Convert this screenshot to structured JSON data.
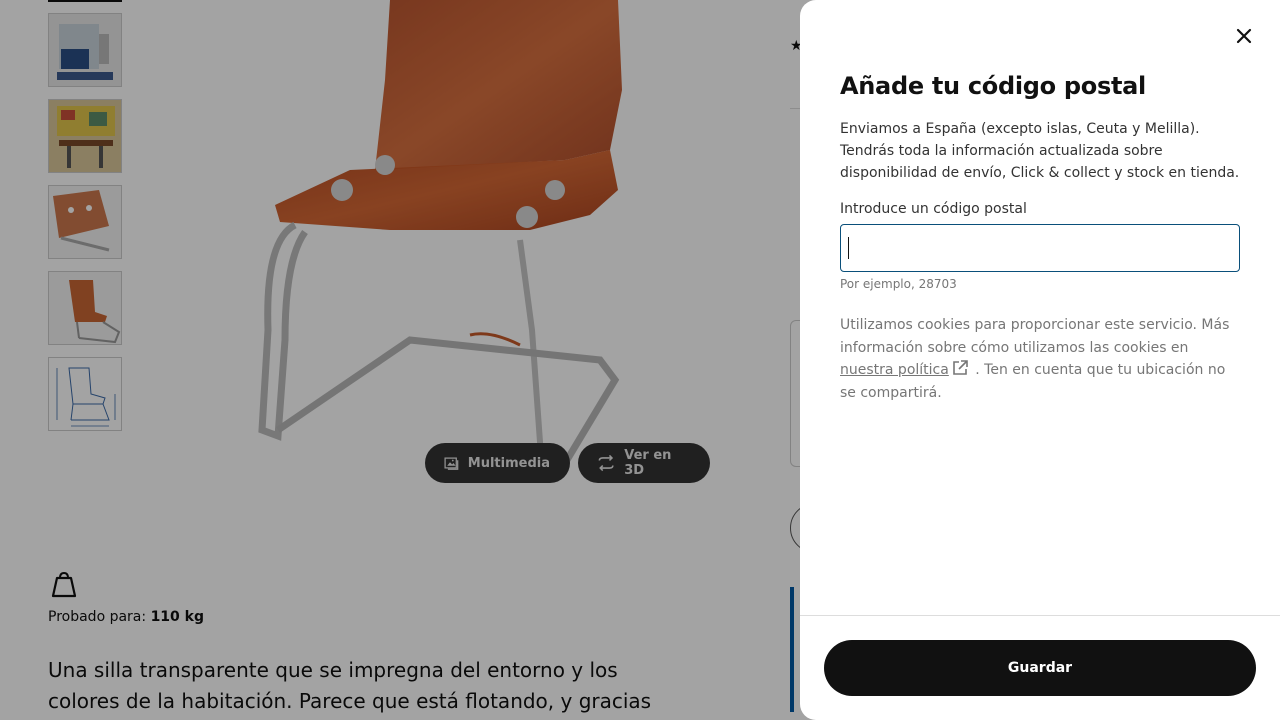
{
  "background": {
    "gallery": {
      "thumbnails": [
        "bathroom-scene",
        "cafe-scene",
        "chair-detail",
        "chair-side",
        "chair-dimensions"
      ],
      "buttons": {
        "multimedia": "Multimedia",
        "view_3d": "Ver en 3D"
      }
    },
    "tested": {
      "prefix": "Probado para:",
      "value": "110 kg"
    },
    "description": "Una silla transparente que se impregna del entorno y los colores de la habitación. Parece que está flotando, y gracias a"
  },
  "modal": {
    "title": "Añade tu código postal",
    "intro": "Enviamos a España (excepto islas, Ceuta y Melilla). Tendrás toda la información actualizada sobre disponibilidad de envío, Click & collect y stock en tienda.",
    "postal_label": "Introduce un código postal",
    "postal_value": "",
    "postal_hint": "Por ejemplo, 28703",
    "cookie_text_before": "Utilizamos cookies para proporcionar este servicio. Más información sobre cómo utilizamos las cookies en",
    "cookie_link": "nuestra política",
    "cookie_text_after": ". Ten en cuenta que tu ubicación no se compartirá.",
    "save_label": "Guardar",
    "icons": {
      "close": "close-icon",
      "external_link": "external-link-icon"
    }
  },
  "colors": {
    "field_border": "#0a4f7a",
    "button_bg": "#111111",
    "accent_blue": "#0058a3"
  }
}
